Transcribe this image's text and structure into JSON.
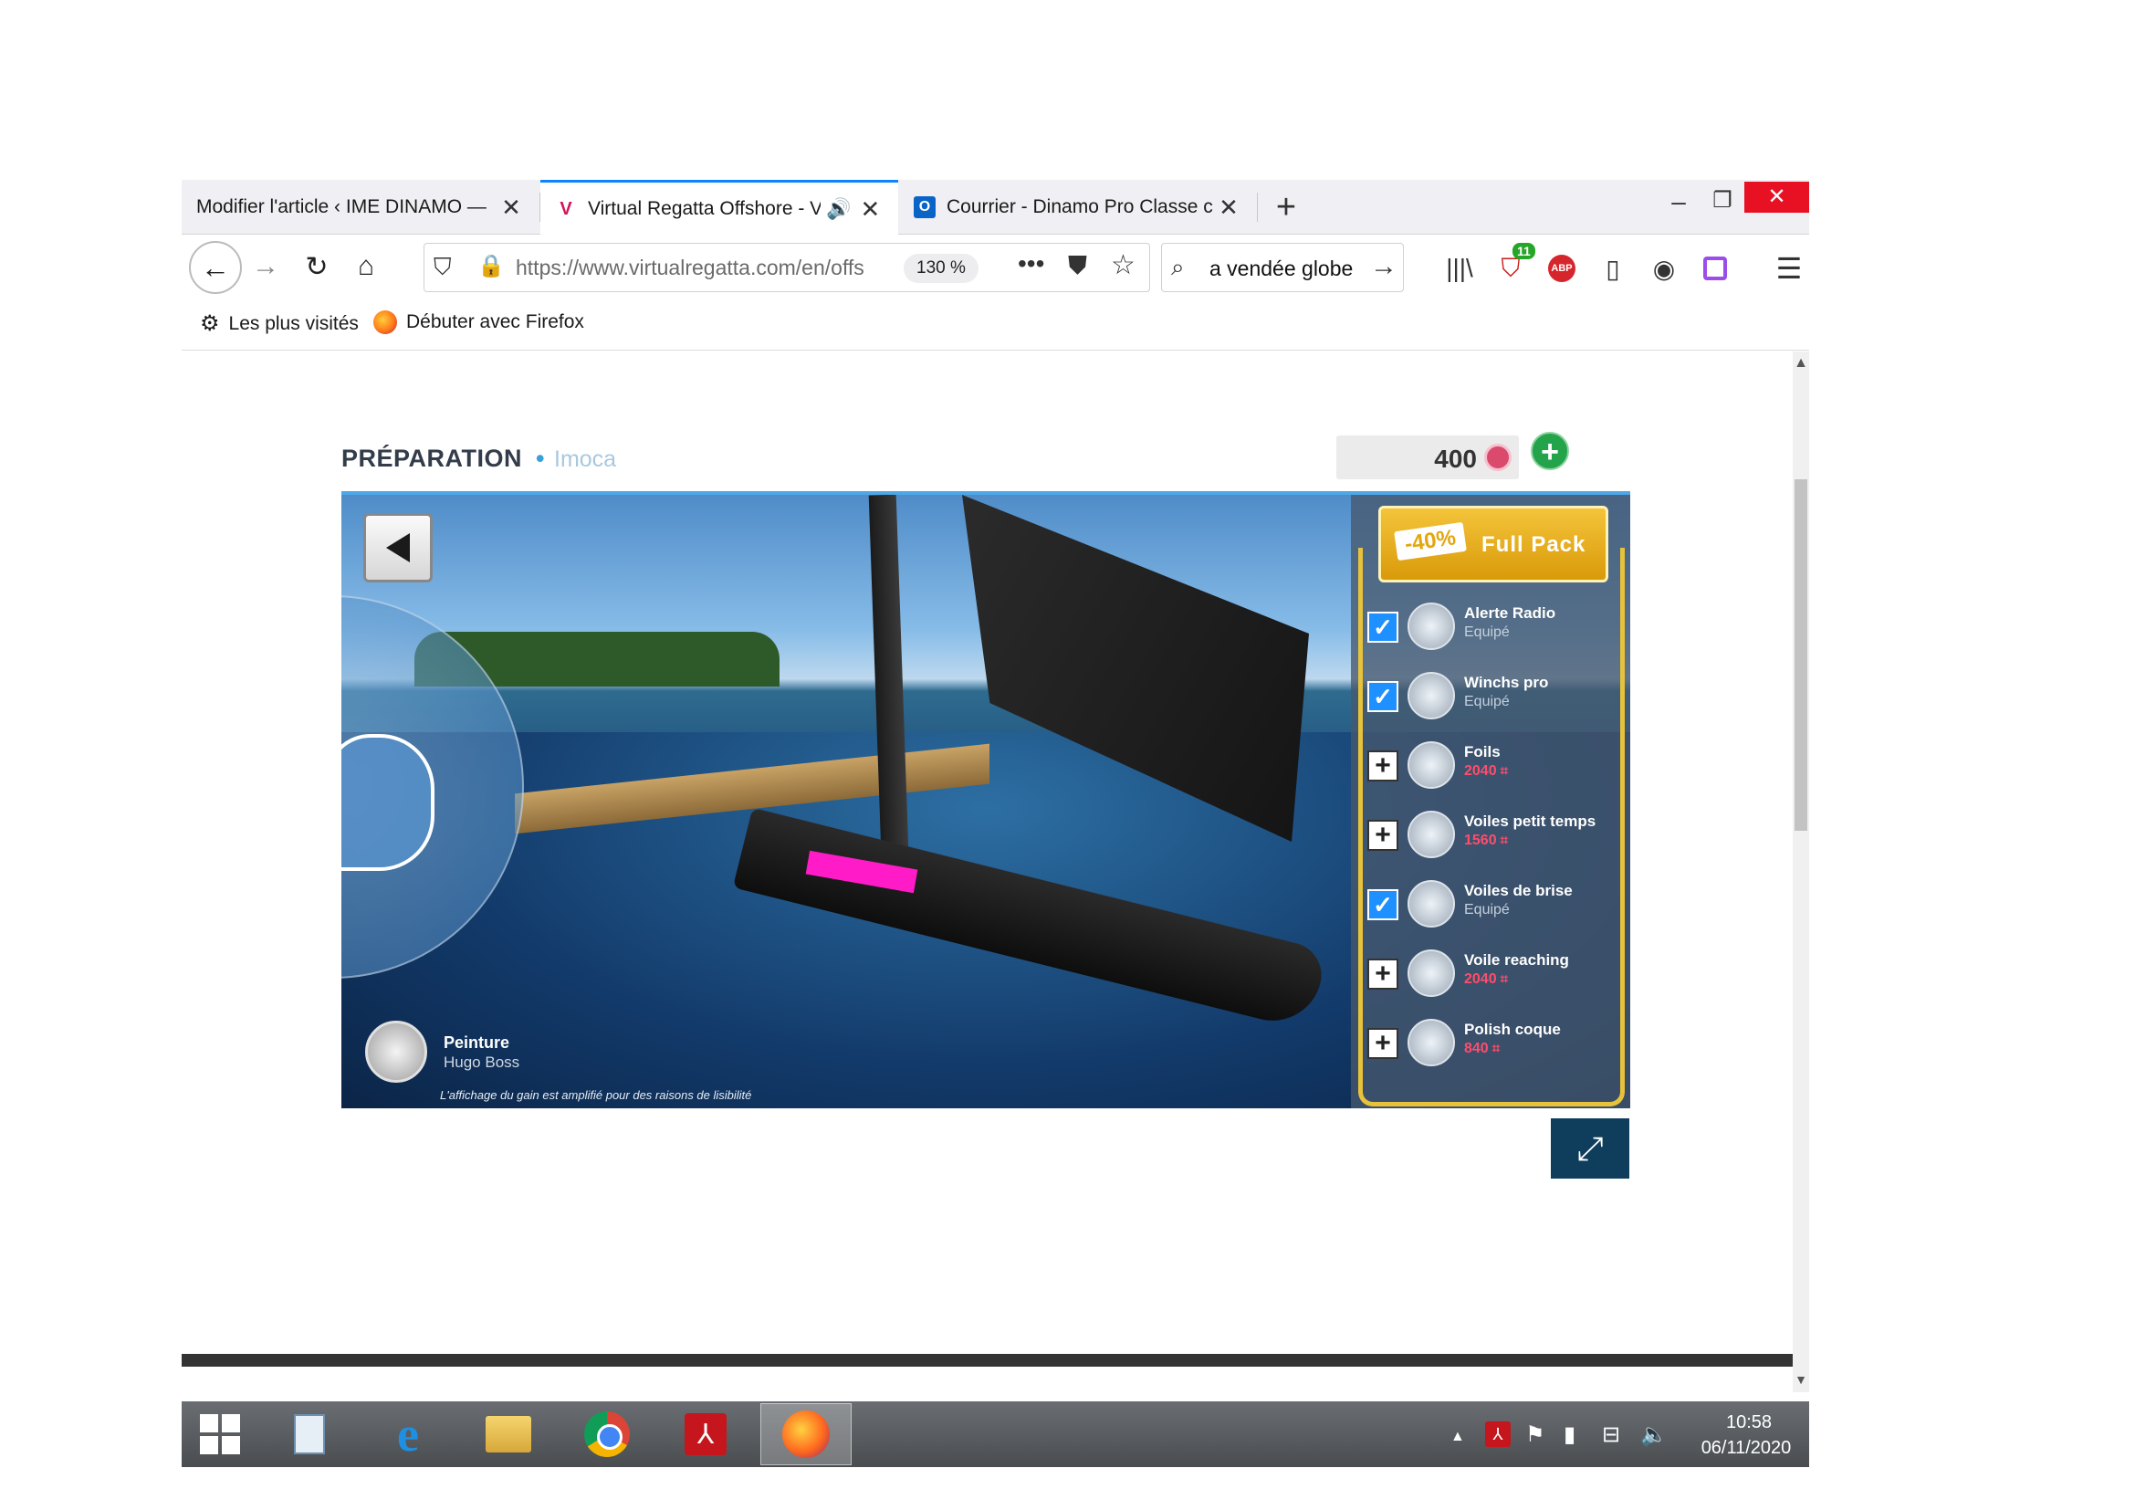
{
  "browser": {
    "tabs": [
      {
        "title": "Modifier l'article ‹ IME DINAMO —",
        "close": "✕"
      },
      {
        "title": "Virtual Regatta Offshore - Vi",
        "close": "✕"
      },
      {
        "title": "Courrier - Dinamo Pro Classe c",
        "close": "✕"
      }
    ],
    "new_tab": "+",
    "window_controls": {
      "minimize": "–",
      "restore": "❐",
      "close": "✕"
    },
    "nav": {
      "back": "←",
      "forward": "→",
      "reload": "↻",
      "home": "⌂"
    },
    "url": "https://www.virtualregatta.com/en/offs",
    "zoom": "130 %",
    "url_more": "•••",
    "search_text": "a vendée globe",
    "shield_badge": "11",
    "abp": "ABP",
    "menu": "☰",
    "bookmarks": [
      {
        "label": "Les plus visités"
      },
      {
        "label": "Débuter avec Firefox"
      }
    ]
  },
  "game": {
    "title": "PRÉPARATION",
    "separator": "•",
    "subtitle": "Imoca",
    "credits": "400",
    "add_credits": "+",
    "paint": {
      "label": "Peinture",
      "value": "Hugo Boss"
    },
    "disclaimer": "L'affichage du gain est amplifié pour des raisons de lisibilité",
    "full_pack": {
      "discount": "-40%",
      "label": "Full Pack"
    },
    "items": [
      {
        "name": "Alerte Radio",
        "status": "Equipé",
        "equipped": true
      },
      {
        "name": "Winchs pro",
        "status": "Equipé",
        "equipped": true
      },
      {
        "name": "Foils",
        "price": "2040",
        "equipped": false
      },
      {
        "name": "Voiles petit temps",
        "price": "1560",
        "equipped": false
      },
      {
        "name": "Voiles de brise",
        "status": "Equipé",
        "equipped": true
      },
      {
        "name": "Voile reaching",
        "price": "2040",
        "equipped": false
      },
      {
        "name": "Polish coque",
        "price": "840",
        "equipped": false
      }
    ],
    "expand": "⤢"
  },
  "taskbar": {
    "time": "10:58",
    "date": "06/11/2020"
  },
  "colors": {
    "accent_tab": "#0a84ff",
    "close_red": "#e81123",
    "shop_gold": "#e7c23a",
    "checkbox_blue": "#1e90ff",
    "price_red": "#ff4d6d"
  }
}
